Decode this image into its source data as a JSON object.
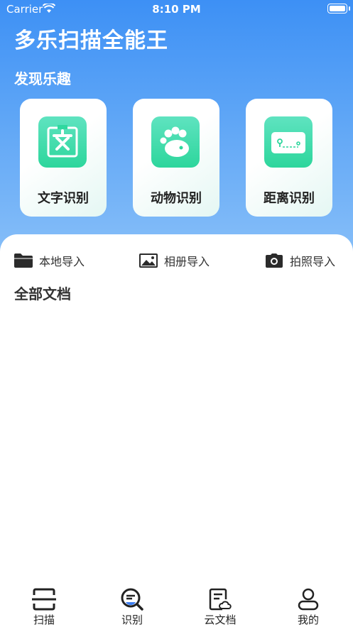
{
  "status_bar": {
    "carrier": "Carrier",
    "time": "8:10 PM"
  },
  "app_title": "多乐扫描全能王",
  "fun_section": {
    "title": "发现乐趣",
    "cards": [
      {
        "label": "文字识别",
        "icon": "text-recognition-icon"
      },
      {
        "label": "动物识别",
        "icon": "paw-icon"
      },
      {
        "label": "距离识别",
        "icon": "ruler-card-icon"
      }
    ]
  },
  "import_bar": {
    "local": "本地导入",
    "album": "相册导入",
    "camera": "拍照导入"
  },
  "documents": {
    "title": "全部文档"
  },
  "tab_bar": {
    "tabs": [
      {
        "label": "扫描",
        "icon": "scan-icon"
      },
      {
        "label": "识别",
        "icon": "recognize-icon",
        "active": true
      },
      {
        "label": "云文档",
        "icon": "cloud-doc-icon"
      },
      {
        "label": "我的",
        "icon": "profile-icon"
      }
    ]
  },
  "colors": {
    "primary": "#3d90f5",
    "card_icon": "#2dd69c",
    "active_tab_accent": "#3d7ef0"
  }
}
